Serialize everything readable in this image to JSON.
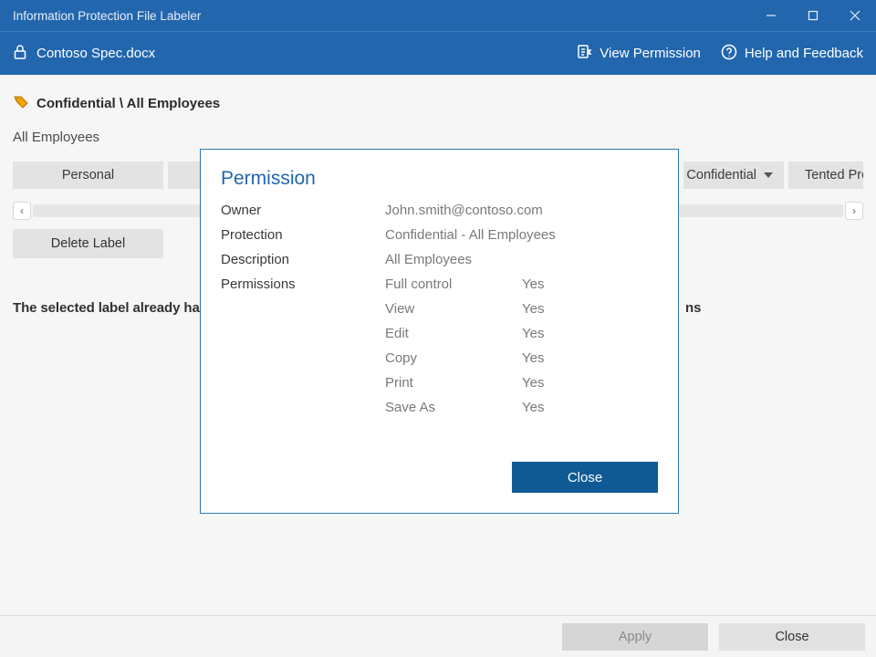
{
  "titlebar": {
    "title": "Information Protection File Labeler"
  },
  "cmdbar": {
    "filename": "Contoso Spec.docx",
    "view_permission": "View Permission",
    "help_feedback": "Help and Feedback"
  },
  "content": {
    "label_path": "Confidential \\ All Employees",
    "sub_text": "All Employees",
    "labels": {
      "l0": "Personal",
      "l1_partial": "",
      "l3_partial": "Confidential",
      "l4_partial": "Tented Projec"
    },
    "delete_label": "Delete Label",
    "selected_msg_lead": "The selected label already has",
    "selected_msg_tail": "ns"
  },
  "dialog": {
    "title": "Permission",
    "labels": {
      "owner": "Owner",
      "protection": "Protection",
      "description": "Description",
      "permissions": "Permissions"
    },
    "owner_value": "John.smith@contoso.com",
    "protection_value": "Confidential - All Employees",
    "description_value": "All Employees",
    "perms": {
      "full_control": {
        "name": "Full control",
        "yn": "Yes"
      },
      "view": {
        "name": "View",
        "yn": "Yes"
      },
      "edit": {
        "name": "Edit",
        "yn": "Yes"
      },
      "copy": {
        "name": "Copy",
        "yn": "Yes"
      },
      "print": {
        "name": "Print",
        "yn": "Yes"
      },
      "saveas": {
        "name": "Save As",
        "yn": "Yes"
      }
    },
    "close": "Close"
  },
  "footer": {
    "apply": "Apply",
    "close": "Close"
  }
}
